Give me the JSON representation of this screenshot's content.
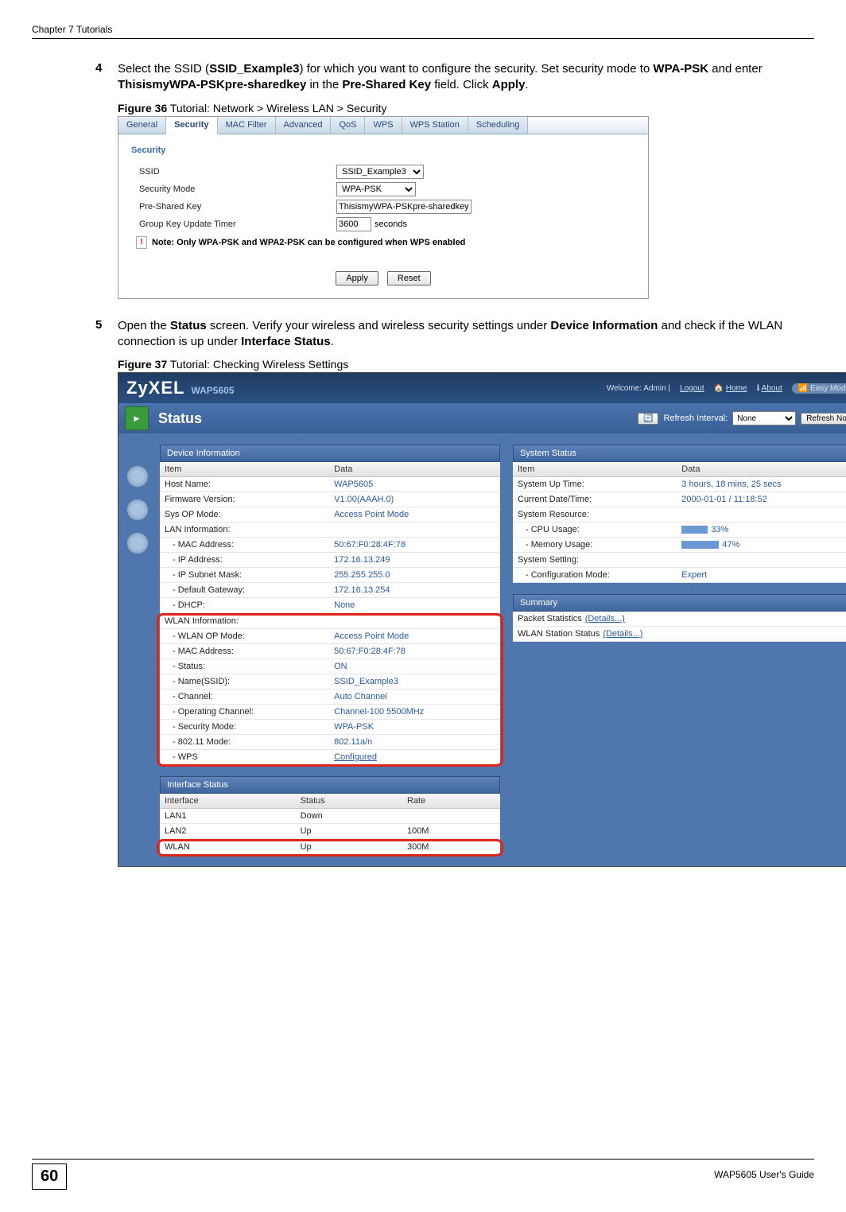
{
  "header": {
    "chapter": "Chapter 7 Tutorials"
  },
  "step4": {
    "num": "4",
    "text_a": "Select the SSID (",
    "ssid": "SSID_Example3",
    "text_b": ") for which you want to configure the security. Set security mode to ",
    "wpa": "WPA-PSK",
    "text_c": " and enter ",
    "key": "ThisismyWPA-PSKpre-sharedkey",
    "text_d": " in the ",
    "field": "Pre-Shared Key",
    "text_e": " field. Click ",
    "apply": "Apply",
    "text_f": "."
  },
  "fig36": {
    "caption_b": "Figure 36",
    "caption_t": "   Tutorial: Network > Wireless LAN > Security",
    "tabs": [
      "General",
      "Security",
      "MAC Filter",
      "Advanced",
      "QoS",
      "WPS",
      "WPS Station",
      "Scheduling"
    ],
    "section": "Security",
    "rows": {
      "ssid_l": "SSID",
      "ssid_v": "SSID_Example3",
      "mode_l": "Security Mode",
      "mode_v": "WPA-PSK",
      "psk_l": "Pre-Shared Key",
      "psk_v": "ThisismyWPA-PSKpre-sharedkey",
      "gkt_l": "Group Key Update Timer",
      "gkt_v": "3600",
      "gkt_u": "seconds"
    },
    "note": "Note: Only WPA-PSK and WPA2-PSK can be configured when WPS enabled",
    "apply": "Apply",
    "reset": "Reset"
  },
  "step5": {
    "num": "5",
    "t1": "Open the ",
    "b1": "Status",
    "t2": " screen. Verify your wireless and wireless security settings under ",
    "b2": "Device Information",
    "t3": " and check if the WLAN connection is up under ",
    "b3": "Interface Status",
    "t4": "."
  },
  "fig37": {
    "caption_b": "Figure 37",
    "caption_t": "   Tutorial: Checking Wireless Settings",
    "brand": "ZyXEL",
    "model": "WAP5605",
    "welcome": "Welcome: Admin |",
    "logout": "Logout",
    "home": "Home",
    "about": "About",
    "easy": "Easy Mode",
    "title": "Status",
    "refresh_lbl": "Refresh Interval:",
    "refresh_sel": "None",
    "refresh_btn": "Refresh Now",
    "dev": {
      "head": "Device Information",
      "col1": "Item",
      "col2": "Data",
      "rows": [
        {
          "k": "Host Name:",
          "v": "WAP5605"
        },
        {
          "k": "Firmware Version:",
          "v": "V1.00(AAAH.0)"
        },
        {
          "k": "Sys OP Mode:",
          "v": "Access Point Mode"
        },
        {
          "k": "LAN Information:",
          "v": ""
        },
        {
          "k": "- MAC Address:",
          "v": "50:67:F0:28:4F:78",
          "i": 1
        },
        {
          "k": "- IP Address:",
          "v": "172.16.13.249",
          "i": 1
        },
        {
          "k": "- IP Subnet Mask:",
          "v": "255.255.255.0",
          "i": 1
        },
        {
          "k": "- Default Gateway:",
          "v": "172.16.13.254",
          "i": 1
        },
        {
          "k": "- DHCP:",
          "v": "None",
          "i": 1
        }
      ],
      "wlan": [
        {
          "k": "WLAN Information:",
          "v": ""
        },
        {
          "k": "- WLAN OP Mode:",
          "v": "Access Point Mode",
          "i": 1
        },
        {
          "k": "- MAC Address:",
          "v": "50:67:F0:28:4F:78",
          "i": 1
        },
        {
          "k": "- Status:",
          "v": "ON",
          "i": 1
        },
        {
          "k": "- Name(SSID):",
          "v": "SSID_Example3",
          "i": 1
        },
        {
          "k": "- Channel:",
          "v": "Auto Channel",
          "i": 1
        },
        {
          "k": "- Operating Channel:",
          "v": "Channel-100 5500MHz",
          "i": 1
        },
        {
          "k": "- Security Mode:",
          "v": "WPA-PSK",
          "i": 1
        },
        {
          "k": "- 802.11 Mode:",
          "v": "802.11a/n",
          "i": 1
        },
        {
          "k": "- WPS",
          "v": "Configured",
          "i": 1,
          "u": 1
        }
      ]
    },
    "iface": {
      "head": "Interface Status",
      "cols": [
        "Interface",
        "Status",
        "Rate"
      ],
      "rows": [
        {
          "a": "LAN1",
          "b": "Down",
          "c": ""
        },
        {
          "a": "LAN2",
          "b": "Up",
          "c": "100M"
        },
        {
          "a": "WLAN",
          "b": "Up",
          "c": "300M",
          "hl": 1
        }
      ]
    },
    "sys": {
      "head": "System Status",
      "col1": "Item",
      "col2": "Data",
      "rows": [
        {
          "k": "System Up Time:",
          "v": "3 hours, 18 mins, 25 secs"
        },
        {
          "k": "Current Date/Time:",
          "v": "2000-01-01 / 11:18:52"
        },
        {
          "k": "System Resource:",
          "v": ""
        },
        {
          "k": "- CPU Usage:",
          "v": "33%",
          "i": 1,
          "bar": 33
        },
        {
          "k": "- Memory Usage:",
          "v": "47%",
          "i": 1,
          "bar": 47
        },
        {
          "k": "System Setting:",
          "v": ""
        },
        {
          "k": "- Configuration Mode:",
          "v": "Expert",
          "i": 1
        }
      ]
    },
    "sum": {
      "head": "Summary",
      "rows": [
        {
          "t": "Packet Statistics",
          "d": "(Details...)"
        },
        {
          "t": "WLAN Station Status",
          "d": "(Details...)"
        }
      ]
    }
  },
  "footer": {
    "pagenum": "60",
    "guide": "WAP5605 User's Guide"
  }
}
